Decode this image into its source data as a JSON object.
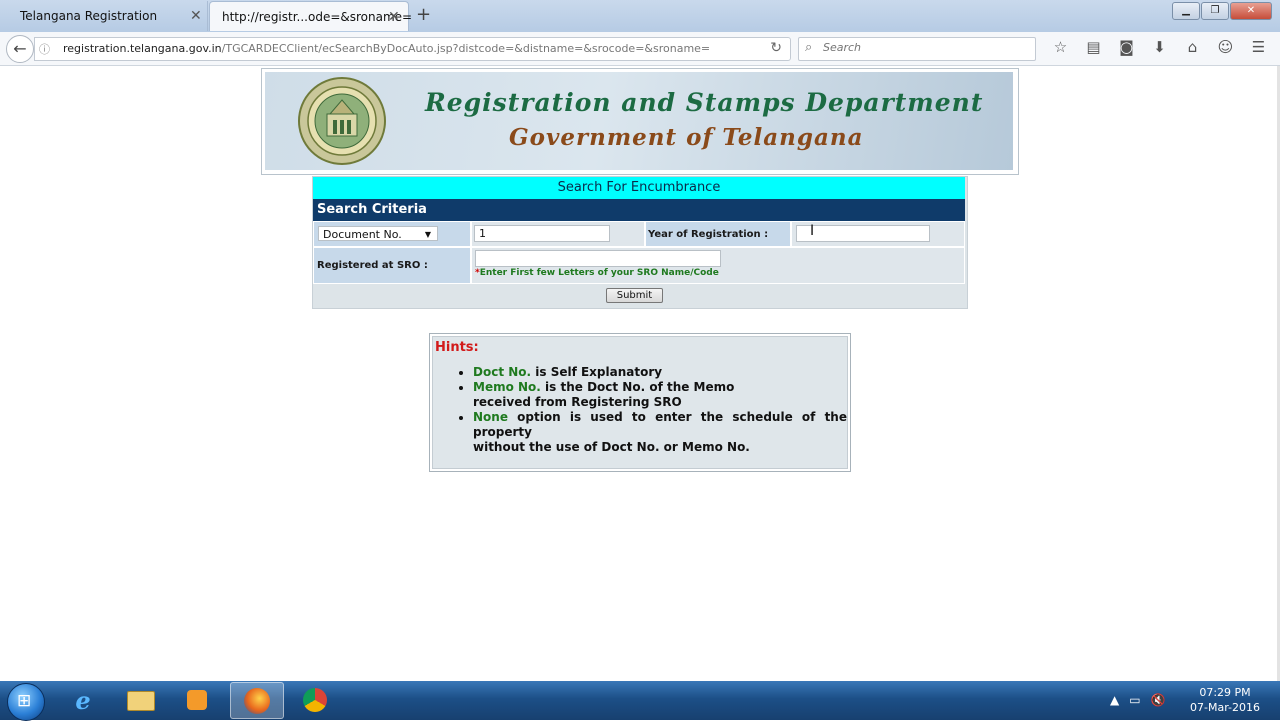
{
  "browser": {
    "tabs": [
      {
        "label": "Telangana Registration",
        "active": false
      },
      {
        "label": "http://registr...ode=&sroname=",
        "active": true
      }
    ],
    "new_tab": "+",
    "url_domain": "registration.telangana.gov.in",
    "url_path": "/TGCARDECClient/ecSearchByDocAuto.jsp?distcode=&distname=&srocode=&sroname=",
    "search_placeholder": "Search"
  },
  "banner": {
    "title": "Registration and Stamps Department",
    "subtitle": "Government of Telangana"
  },
  "form": {
    "header": "Search For Encumbrance",
    "criteria_header": "Search Criteria",
    "doc_type_selected": "Document No.",
    "doc_number_value": "1",
    "year_label": "Year of Registration :",
    "year_value": "",
    "sro_label": "Registered at SRO :",
    "sro_value": "",
    "sro_hint_asterisk": "*",
    "sro_hint": "Enter First few Letters of your SRO Name/Code",
    "submit_label": "Submit"
  },
  "hints": {
    "title": "Hints:",
    "items": [
      {
        "keyword": "Doct No.",
        "text": " is Self Explanatory"
      },
      {
        "keyword": "Memo No.",
        "text": " is the Doct No. of the Memo",
        "text2": "received from Registering SRO"
      },
      {
        "keyword": "None",
        "text": " option is used to enter the schedule of the property",
        "text2": "without the use of Doct No. or Memo No."
      }
    ]
  },
  "taskbar": {
    "time": "07:29 PM",
    "date": "07-Mar-2016"
  },
  "colors": {
    "cyan_header": "#00ffff",
    "criteria_header": "#0f3b6a",
    "label_cell": "#c7d9ea",
    "keyword_green": "#1f7a1f",
    "hint_red": "#d21a1a"
  },
  "icons": [
    "back-arrow-icon",
    "info-icon",
    "reload-icon",
    "search-icon",
    "bookmark-star-icon",
    "reading-list-icon",
    "pocket-icon",
    "download-icon",
    "home-icon",
    "chat-icon",
    "menu-icon",
    "ie-icon",
    "explorer-icon",
    "media-player-icon",
    "firefox-icon",
    "chrome-icon",
    "volume-muted-icon"
  ]
}
